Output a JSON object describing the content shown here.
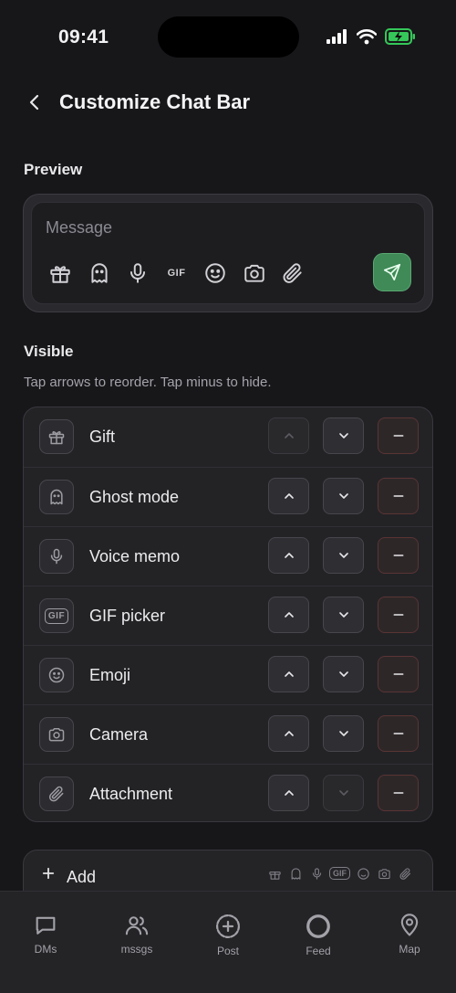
{
  "status_bar": {
    "time": "09:41"
  },
  "header": {
    "title": "Customize Chat Bar"
  },
  "preview": {
    "section_label": "Preview",
    "message_placeholder": "Message",
    "gif_label": "GIF"
  },
  "visible": {
    "section_label": "Visible",
    "hint": "Tap arrows to reorder. Tap minus to hide.",
    "items": [
      {
        "label": "Gift",
        "icon": "gift-icon",
        "up_enabled": false,
        "down_enabled": true
      },
      {
        "label": "Ghost mode",
        "icon": "ghost-icon",
        "up_enabled": true,
        "down_enabled": true
      },
      {
        "label": "Voice memo",
        "icon": "microphone-icon",
        "up_enabled": true,
        "down_enabled": true
      },
      {
        "label": "GIF picker",
        "icon": "gif-icon",
        "icon_text": "GIF",
        "up_enabled": true,
        "down_enabled": true
      },
      {
        "label": "Emoji",
        "icon": "emoji-icon",
        "up_enabled": true,
        "down_enabled": true
      },
      {
        "label": "Camera",
        "icon": "camera-icon",
        "up_enabled": true,
        "down_enabled": true
      },
      {
        "label": "Attachment",
        "icon": "paperclip-icon",
        "up_enabled": true,
        "down_enabled": false
      }
    ]
  },
  "add_card": {
    "label": "Add",
    "gif_label": "GIF"
  },
  "tabbar": {
    "items": [
      {
        "label": "DMs",
        "icon": "chat-bubble-icon"
      },
      {
        "label": "mssgs",
        "icon": "people-icon"
      },
      {
        "label": "Post",
        "icon": "plus-circle-icon"
      },
      {
        "label": "Feed",
        "icon": "ring-icon"
      },
      {
        "label": "Map",
        "icon": "map-pin-icon"
      }
    ]
  },
  "colors": {
    "background": "#17171a",
    "accent_send": "#3f8a57",
    "remove_border": "#5a3434"
  }
}
